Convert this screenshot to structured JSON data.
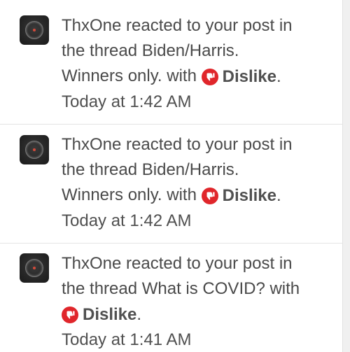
{
  "alerts": [
    {
      "user": "ThxOne",
      "text_line1": "ThxOne reacted to your post in",
      "text_line2": "the thread Biden/Harris.",
      "text_line3_prefix": "Winners only. with",
      "reaction": "Dislike",
      "suffix": ".",
      "time": "Today at 1:42 AM"
    },
    {
      "user": "ThxOne",
      "text_line1": "ThxOne reacted to your post in",
      "text_line2": "the thread Biden/Harris.",
      "text_line3_prefix": "Winners only. with",
      "reaction": "Dislike",
      "suffix": ".",
      "time": "Today at 1:42 AM"
    },
    {
      "user": "ThxOne",
      "text_line1": "ThxOne reacted to your post in",
      "text_line2": "the thread What is COVID? with",
      "reaction": "Dislike",
      "suffix": ".",
      "time": "Today at 1:41 AM"
    }
  ],
  "icons": {
    "avatar": "user-avatar-icon",
    "reaction": "thumbs-down-icon"
  },
  "colors": {
    "text": "#4a4a4a",
    "dislike_red": "#e0262b",
    "divider": "#e4e4e4",
    "accent_edge": "#c8572e"
  }
}
